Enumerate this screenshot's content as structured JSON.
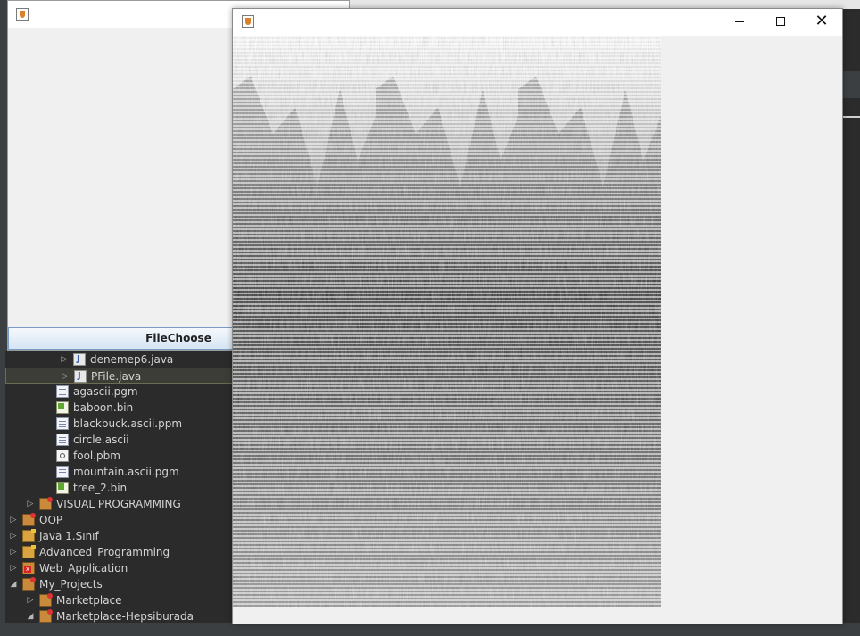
{
  "left_window": {
    "button_label": "FileChoose"
  },
  "tree": {
    "rows": [
      {
        "label": "denemep6.java",
        "icon": "java-file-icon",
        "indent": 3,
        "expandable": true,
        "expanded": false,
        "selected": false
      },
      {
        "label": "PFile.java",
        "icon": "java-file-icon",
        "indent": 3,
        "expandable": true,
        "expanded": false,
        "selected": true
      },
      {
        "label": "agascii.pgm",
        "icon": "text-file-icon",
        "indent": 2,
        "expandable": false,
        "selected": false
      },
      {
        "label": "baboon.bin",
        "icon": "binary-file-icon",
        "indent": 2,
        "expandable": false,
        "selected": false
      },
      {
        "label": "blackbuck.ascii.ppm",
        "icon": "text-file-icon",
        "indent": 2,
        "expandable": false,
        "selected": false
      },
      {
        "label": "circle.ascii",
        "icon": "text-file-icon",
        "indent": 2,
        "expandable": false,
        "selected": false
      },
      {
        "label": "fool.pbm",
        "icon": "image-file-icon",
        "indent": 2,
        "expandable": false,
        "selected": false
      },
      {
        "label": "mountain.ascii.pgm",
        "icon": "text-file-icon",
        "indent": 2,
        "expandable": false,
        "selected": false
      },
      {
        "label": "tree_2.bin",
        "icon": "binary-file-icon",
        "indent": 2,
        "expandable": false,
        "selected": false
      },
      {
        "label": "VISUAL PROGRAMMING",
        "icon": "project-error-icon",
        "indent": 1,
        "expandable": true,
        "expanded": false,
        "selected": false
      },
      {
        "label": "OOP",
        "icon": "project-error-icon",
        "indent": 0,
        "expandable": true,
        "expanded": false,
        "selected": false
      },
      {
        "label": "Java 1.Sınıf",
        "icon": "folder-icon",
        "indent": 0,
        "expandable": true,
        "expanded": false,
        "selected": false
      },
      {
        "label": "Advanced_Programming",
        "icon": "folder-icon",
        "indent": 0,
        "expandable": true,
        "expanded": false,
        "selected": false
      },
      {
        "label": "Web_Application",
        "icon": "project-x-icon",
        "indent": 0,
        "expandable": true,
        "expanded": false,
        "selected": false
      },
      {
        "label": "My_Projects",
        "icon": "project-error-icon",
        "indent": 0,
        "expandable": true,
        "expanded": true,
        "selected": false
      },
      {
        "label": "Marketplace",
        "icon": "project-error-icon",
        "indent": 1,
        "expandable": true,
        "expanded": false,
        "selected": false
      },
      {
        "label": "Marketplace-Hepsiburada",
        "icon": "project-error-icon",
        "indent": 1,
        "expandable": true,
        "expanded": true,
        "selected": false
      }
    ]
  },
  "main_window": {
    "title": "",
    "close_glyph": "✕",
    "image_description": "grayscale mountain image rendered with horizontal scanline artifacts, tiled three times horizontally"
  }
}
